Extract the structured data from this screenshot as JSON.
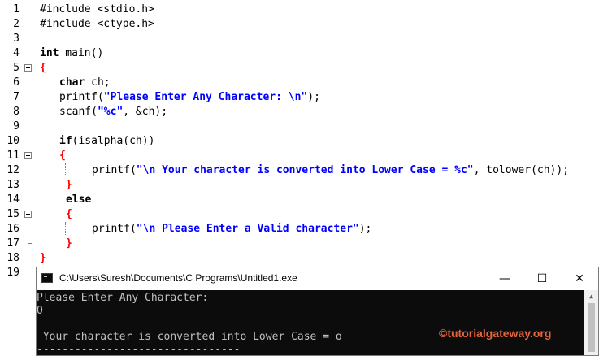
{
  "editor": {
    "line_numbers": [
      "1",
      "2",
      "3",
      "4",
      "5",
      "6",
      "7",
      "8",
      "9",
      "10",
      "11",
      "12",
      "13",
      "14",
      "15",
      "16",
      "17",
      "18",
      "19"
    ],
    "lines": {
      "l1": "#include <stdio.h>",
      "l2": "#include <ctype.h>",
      "l4_kw": "int",
      "l4_rest": " main()",
      "l5_brace": "{",
      "l6_kw": "char",
      "l6_rest": " ch;",
      "l7_fn": "printf(",
      "l7_str": "\"Please Enter Any Character: \\n\"",
      "l7_end": ");",
      "l8_fn": "scanf(",
      "l8_str": "\"%c\"",
      "l8_end": ", &ch);",
      "l10_kw": "if",
      "l10_rest": "(isalpha(ch))",
      "l11_brace": "{",
      "l12_fn": "printf(",
      "l12_str": "\"\\n Your character is converted into Lower Case = %c\"",
      "l12_end": ", tolower(ch));",
      "l13_brace": "}",
      "l14_kw": "else",
      "l15_brace": "{",
      "l16_fn": "printf(",
      "l16_str": "\"\\n Please Enter a Valid character\"",
      "l16_end": ");",
      "l17_brace": "}",
      "l18_brace": "}"
    }
  },
  "console": {
    "title": "C:\\Users\\Suresh\\Documents\\C Programs\\Untitled1.exe",
    "minimize_glyph": "—",
    "maximize_glyph": "☐",
    "close_glyph": "✕",
    "output": {
      "line1": "Please Enter Any Character:",
      "line2": "O",
      "line3": "",
      "line4": " Your character is converted into Lower Case = o",
      "line5": "--------------------------------"
    }
  },
  "watermark": {
    "icon": "©",
    "text": "tutorialgateway.org"
  },
  "colors": {
    "string": "#0000ff",
    "brace": "#ff0000",
    "terminal_bg": "#0c0c0c",
    "terminal_fg": "#c0c0c0",
    "watermark": "#e8643c"
  }
}
